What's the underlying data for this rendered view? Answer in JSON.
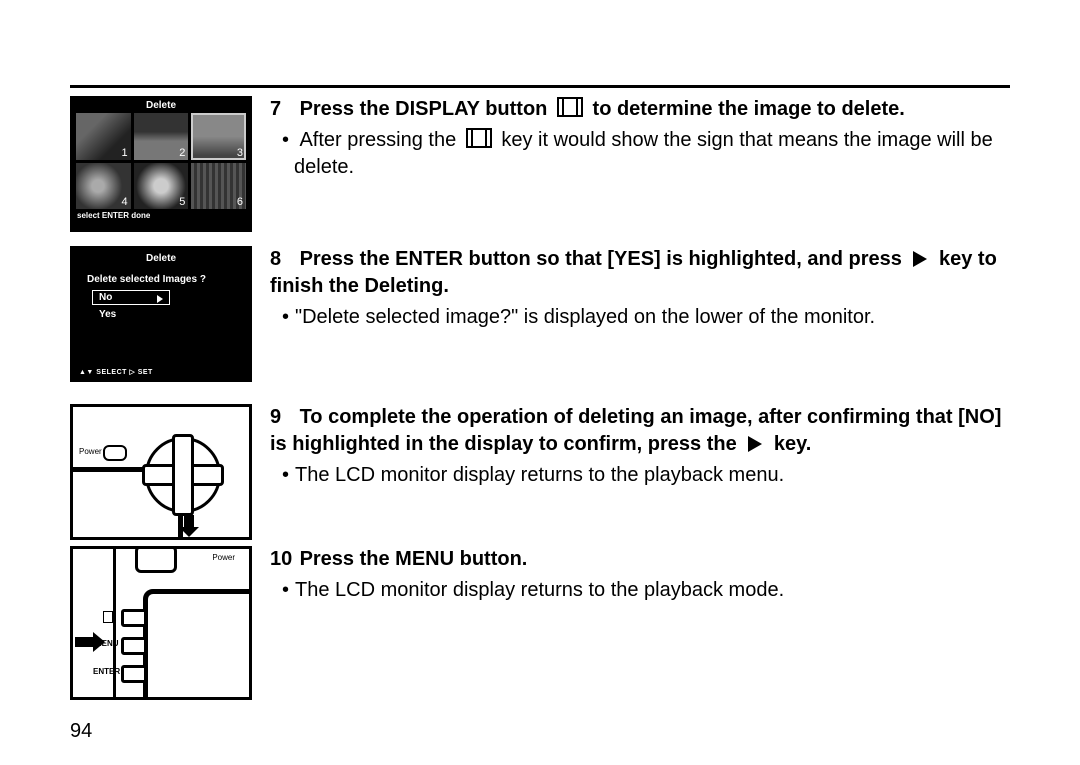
{
  "page_number": "94",
  "lcd1": {
    "title": "Delete",
    "footer": "select  ENTER  done",
    "thumbs": [
      "1",
      "2",
      "3",
      "4",
      "5",
      "6"
    ]
  },
  "lcd2": {
    "title": "Delete",
    "question": "Delete selected Images ?",
    "opt_no": "No",
    "opt_yes": "Yes",
    "footer": "▲▼ SELECT      ▷ SET"
  },
  "cam1": {
    "power": "Power"
  },
  "cam2": {
    "power": "Power",
    "btn2": "MENU",
    "btn3": "ENTER"
  },
  "steps": {
    "s7": {
      "num": "7",
      "head_a": "Press the DISPLAY button",
      "head_b": "to determine the image to delete.",
      "bullet_a": "After pressing the",
      "bullet_b": "key it would show the sign that means the image will be delete."
    },
    "s8": {
      "num": "8",
      "head_a": "Press the ENTER button so that [YES] is highlighted, and press",
      "head_b": "key to finish the Deleting.",
      "bullet": "\"Delete selected image?\" is displayed on the lower of the monitor."
    },
    "s9": {
      "num": "9",
      "head_a": "To complete the operation of deleting an image, after confirming that [NO] is highlighted in the display to confirm, press the",
      "head_b": "key.",
      "bullet": "The LCD monitor display returns to the playback menu."
    },
    "s10": {
      "num": "10",
      "head": "Press the MENU button.",
      "bullet": "The LCD monitor display returns to the playback mode."
    }
  }
}
